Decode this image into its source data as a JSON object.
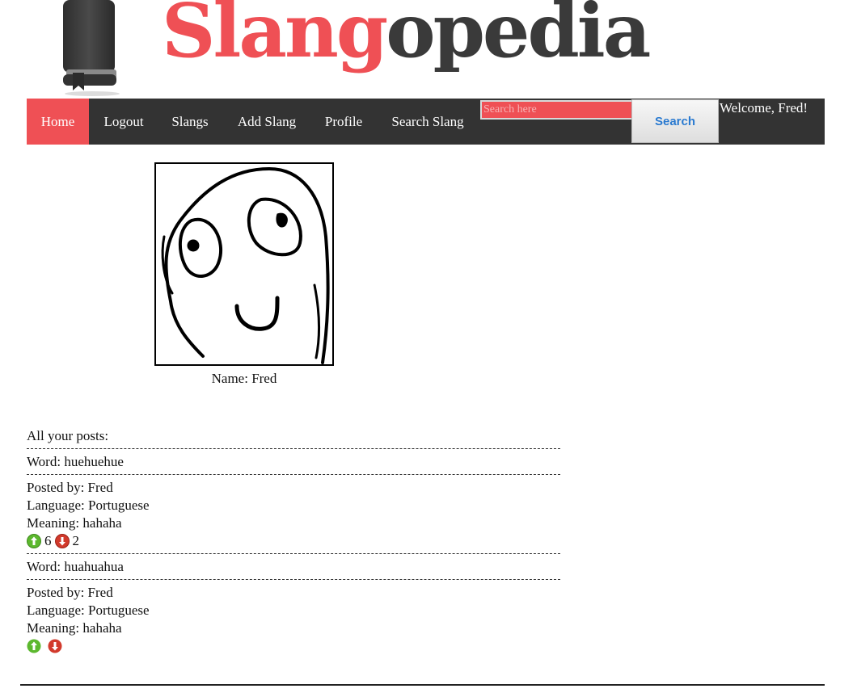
{
  "header": {
    "logo_part1": "Slang",
    "logo_part2": "opedia"
  },
  "nav": {
    "items": [
      {
        "label": "Home",
        "active": true
      },
      {
        "label": "Logout"
      },
      {
        "label": "Slangs"
      },
      {
        "label": "Add Slang"
      },
      {
        "label": "Profile"
      },
      {
        "label": "Search Slang"
      }
    ],
    "search_placeholder": "Search here",
    "search_button": "Search",
    "welcome": "Welcome, Fred!"
  },
  "profile": {
    "name_label": "Name: Fred"
  },
  "posts": {
    "heading": "All your posts:",
    "items": [
      {
        "word": "Word: huehuehue",
        "posted_by": "Posted by: Fred",
        "language": "Language: Portuguese",
        "meaning": "Meaning: hahaha",
        "upvotes": "6",
        "downvotes": "2"
      },
      {
        "word": "Word: huahuahua",
        "posted_by": "Posted by: Fred",
        "language": "Language: Portuguese",
        "meaning": "Meaning: hahaha",
        "upvotes": "",
        "downvotes": ""
      }
    ]
  },
  "colors": {
    "accent": "#ef5055",
    "nav_bg": "#333333",
    "logo_dark": "#3a3a3a",
    "upvote": "#5cb82e",
    "downvote": "#d23a2c"
  }
}
